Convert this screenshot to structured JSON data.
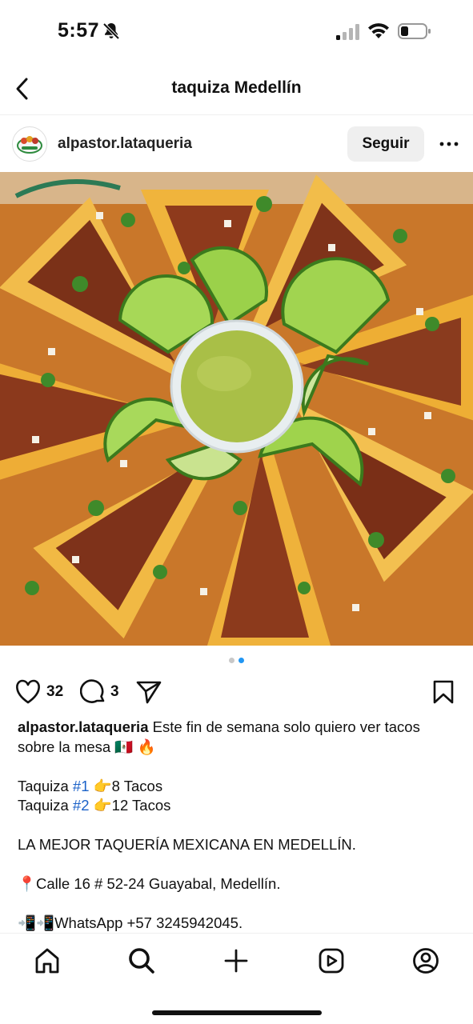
{
  "status_bar": {
    "time": "5:57"
  },
  "header": {
    "title": "taquiza Medellín"
  },
  "post": {
    "username": "alpastor.lataqueria",
    "follow_label": "Seguir",
    "image_alt": "",
    "carousel": {
      "total": 2,
      "active": 2
    },
    "likes": "32",
    "comments": "3",
    "caption": {
      "username": "alpastor.lataqueria",
      "line1": " Este fin de semana solo quiero ver tacos sobre la mesa 🇲🇽 🔥",
      "taquiza1_prefix": "Taquiza ",
      "taquiza1_tag": "#1",
      "taquiza1_suffix": " 👉8 Tacos",
      "taquiza2_prefix": "Taquiza ",
      "taquiza2_tag": "#2",
      "taquiza2_suffix": " 👉12 Tacos",
      "headline": "LA MEJOR TAQUERÍA MEXICANA EN MEDELLÍN.",
      "address": "📍Calle 16 # 52-24 Guayabal, Medellín.",
      "whatsapp": "📲📲WhatsApp +57 3245942045."
    }
  },
  "icons": {
    "back": "chevron-left-icon",
    "more": "ellipsis-icon",
    "like": "heart-icon",
    "comment": "comment-bubble-icon",
    "share": "paper-plane-icon",
    "save": "bookmark-icon",
    "home": "home-icon",
    "search": "search-icon",
    "create": "plus-icon",
    "reels": "reels-icon",
    "profile": "profile-icon"
  },
  "colors": {
    "accent_blue": "#2196f3",
    "hashtag": "#1b62c8",
    "follow_bg": "#efefef"
  }
}
